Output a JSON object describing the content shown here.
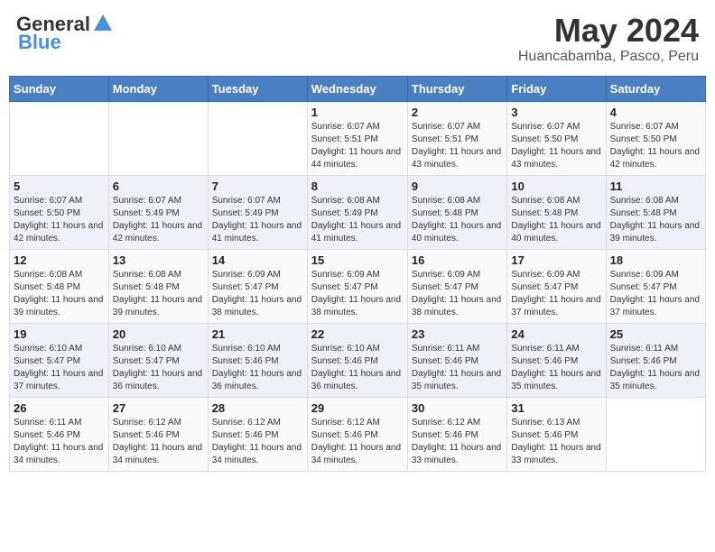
{
  "header": {
    "logo_general": "General",
    "logo_blue": "Blue",
    "month_year": "May 2024",
    "location": "Huancabamba, Pasco, Peru"
  },
  "weekdays": [
    "Sunday",
    "Monday",
    "Tuesday",
    "Wednesday",
    "Thursday",
    "Friday",
    "Saturday"
  ],
  "weeks": [
    [
      {
        "day": "",
        "info": ""
      },
      {
        "day": "",
        "info": ""
      },
      {
        "day": "",
        "info": ""
      },
      {
        "day": "1",
        "info": "Sunrise: 6:07 AM\nSunset: 5:51 PM\nDaylight: 11 hours and 44 minutes."
      },
      {
        "day": "2",
        "info": "Sunrise: 6:07 AM\nSunset: 5:51 PM\nDaylight: 11 hours and 43 minutes."
      },
      {
        "day": "3",
        "info": "Sunrise: 6:07 AM\nSunset: 5:50 PM\nDaylight: 11 hours and 43 minutes."
      },
      {
        "day": "4",
        "info": "Sunrise: 6:07 AM\nSunset: 5:50 PM\nDaylight: 11 hours and 42 minutes."
      }
    ],
    [
      {
        "day": "5",
        "info": "Sunrise: 6:07 AM\nSunset: 5:50 PM\nDaylight: 11 hours and 42 minutes."
      },
      {
        "day": "6",
        "info": "Sunrise: 6:07 AM\nSunset: 5:49 PM\nDaylight: 11 hours and 42 minutes."
      },
      {
        "day": "7",
        "info": "Sunrise: 6:07 AM\nSunset: 5:49 PM\nDaylight: 11 hours and 41 minutes."
      },
      {
        "day": "8",
        "info": "Sunrise: 6:08 AM\nSunset: 5:49 PM\nDaylight: 11 hours and 41 minutes."
      },
      {
        "day": "9",
        "info": "Sunrise: 6:08 AM\nSunset: 5:48 PM\nDaylight: 11 hours and 40 minutes."
      },
      {
        "day": "10",
        "info": "Sunrise: 6:08 AM\nSunset: 5:48 PM\nDaylight: 11 hours and 40 minutes."
      },
      {
        "day": "11",
        "info": "Sunrise: 6:08 AM\nSunset: 5:48 PM\nDaylight: 11 hours and 39 minutes."
      }
    ],
    [
      {
        "day": "12",
        "info": "Sunrise: 6:08 AM\nSunset: 5:48 PM\nDaylight: 11 hours and 39 minutes."
      },
      {
        "day": "13",
        "info": "Sunrise: 6:08 AM\nSunset: 5:48 PM\nDaylight: 11 hours and 39 minutes."
      },
      {
        "day": "14",
        "info": "Sunrise: 6:09 AM\nSunset: 5:47 PM\nDaylight: 11 hours and 38 minutes."
      },
      {
        "day": "15",
        "info": "Sunrise: 6:09 AM\nSunset: 5:47 PM\nDaylight: 11 hours and 38 minutes."
      },
      {
        "day": "16",
        "info": "Sunrise: 6:09 AM\nSunset: 5:47 PM\nDaylight: 11 hours and 38 minutes."
      },
      {
        "day": "17",
        "info": "Sunrise: 6:09 AM\nSunset: 5:47 PM\nDaylight: 11 hours and 37 minutes."
      },
      {
        "day": "18",
        "info": "Sunrise: 6:09 AM\nSunset: 5:47 PM\nDaylight: 11 hours and 37 minutes."
      }
    ],
    [
      {
        "day": "19",
        "info": "Sunrise: 6:10 AM\nSunset: 5:47 PM\nDaylight: 11 hours and 37 minutes."
      },
      {
        "day": "20",
        "info": "Sunrise: 6:10 AM\nSunset: 5:47 PM\nDaylight: 11 hours and 36 minutes."
      },
      {
        "day": "21",
        "info": "Sunrise: 6:10 AM\nSunset: 5:46 PM\nDaylight: 11 hours and 36 minutes."
      },
      {
        "day": "22",
        "info": "Sunrise: 6:10 AM\nSunset: 5:46 PM\nDaylight: 11 hours and 36 minutes."
      },
      {
        "day": "23",
        "info": "Sunrise: 6:11 AM\nSunset: 5:46 PM\nDaylight: 11 hours and 35 minutes."
      },
      {
        "day": "24",
        "info": "Sunrise: 6:11 AM\nSunset: 5:46 PM\nDaylight: 11 hours and 35 minutes."
      },
      {
        "day": "25",
        "info": "Sunrise: 6:11 AM\nSunset: 5:46 PM\nDaylight: 11 hours and 35 minutes."
      }
    ],
    [
      {
        "day": "26",
        "info": "Sunrise: 6:11 AM\nSunset: 5:46 PM\nDaylight: 11 hours and 34 minutes."
      },
      {
        "day": "27",
        "info": "Sunrise: 6:12 AM\nSunset: 5:46 PM\nDaylight: 11 hours and 34 minutes."
      },
      {
        "day": "28",
        "info": "Sunrise: 6:12 AM\nSunset: 5:46 PM\nDaylight: 11 hours and 34 minutes."
      },
      {
        "day": "29",
        "info": "Sunrise: 6:12 AM\nSunset: 5:46 PM\nDaylight: 11 hours and 34 minutes."
      },
      {
        "day": "30",
        "info": "Sunrise: 6:12 AM\nSunset: 5:46 PM\nDaylight: 11 hours and 33 minutes."
      },
      {
        "day": "31",
        "info": "Sunrise: 6:13 AM\nSunset: 5:46 PM\nDaylight: 11 hours and 33 minutes."
      },
      {
        "day": "",
        "info": ""
      }
    ]
  ]
}
